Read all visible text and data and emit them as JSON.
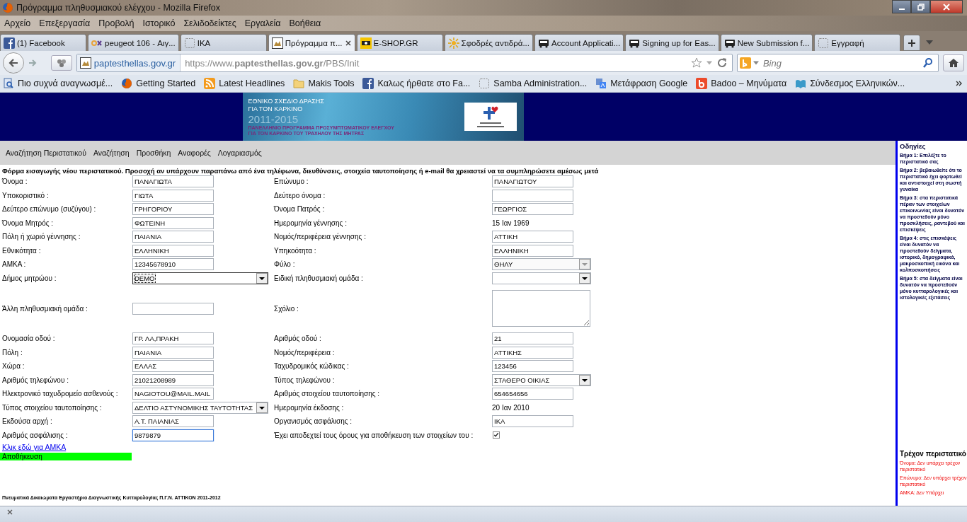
{
  "window": {
    "title": "Πρόγραμμα πληθυσμιακού ελέγχου - Mozilla Firefox"
  },
  "menu": [
    "Αρχείο",
    "Επεξεργασία",
    "Προβολή",
    "Ιστορικό",
    "Σελιδοδείκτες",
    "Εργαλεία",
    "Βοήθεια"
  ],
  "tabs": [
    {
      "label": "(1) Facebook",
      "selected": false
    },
    {
      "label": "peugeot 106 - Αιγ...",
      "selected": false
    },
    {
      "label": "IKA",
      "selected": false
    },
    {
      "label": "Πρόγραμμα π...",
      "selected": true
    },
    {
      "label": "E-SHOP.GR",
      "selected": false
    },
    {
      "label": "Σφοδρές αντιδρά...",
      "selected": false
    },
    {
      "label": "Account Applicati...",
      "selected": false
    },
    {
      "label": "Signing up for Eas...",
      "selected": false
    },
    {
      "label": "New Submission f...",
      "selected": false
    },
    {
      "label": "Εγγραφή",
      "selected": false
    }
  ],
  "address_bar": {
    "site": "paptesthellas.gov.gr",
    "url": "https://www.**paptesthellas.gov.gr**/PBS/Init"
  },
  "search": {
    "placeholder": "Bing"
  },
  "bookmarks": [
    "Πιο συχνά αναγνωσμέ...",
    "Getting Started",
    "Latest Headlines",
    "Makis Tools",
    "Καλως ήρθατε στο Fa...",
    "Samba Administration...",
    "Μετάφραση Google",
    "Badoo – Μηνύματα",
    "Σύνδεσμος Ελληνικών..."
  ],
  "banner": {
    "title_lines": [
      "ΕΘΝΙΚΟ ΣΧΕΔΙΟ ΔΡΑΣΗΣ",
      "ΓΙΑ ΤΟΝ ΚΑΡΚΙΝΟ"
    ],
    "years": "2011-2015",
    "subtitle_lines": [
      "ΠΑΝΕΛΛΗΝΙΟ ΠΡΟΓΡΑΜΜΑ ΠΡΟΣΥΜΠΤΩΜΑΤΙΚΟΥ ΕΛΕΓΧΟΥ",
      "ΓΙΑ ΤΟΝ ΚΑΡΚΙΝΟ ΤΟΥ ΤΡΑΧΗΛΟΥ ΤΗΣ ΜΗΤΡΑΣ"
    ]
  },
  "site_menu": [
    "Αναζήτηση Περιστατικού",
    "Αναζήτηση",
    "Προσθήκη",
    "Αναφορές",
    "Λογαριασμός"
  ],
  "form": {
    "heading": "Φόρμα εισαγωγής νέου περιστατικού. Προσοχή αν υπάρχουν παραπάνω από ένα τηλέφωνα, διευθύνσεις, στοιχεία ταυτοποίησης ή e-mail θα χρειαστεί να τα συμπληρώσετε αμέσως μετά",
    "rows": [
      {
        "left": {
          "label": "Όνομα :",
          "kind": "text",
          "value": "ΠΑΝΑΓΙΩΤΑ",
          "focused": false,
          "disabled": false
        },
        "right": {
          "label": "Επώνυμο :",
          "kind": "text",
          "value": "ΠΑΝΑΓΙΩΤΟΥ",
          "focused": false,
          "disabled": false
        }
      },
      {
        "left": {
          "label": "Υποκοριστικό :",
          "kind": "text",
          "value": "ΓΙΩΤΑ",
          "focused": false,
          "disabled": false
        },
        "right": {
          "label": "Δεύτερο όνομα :",
          "kind": "text",
          "focused": false,
          "disabled": false
        }
      },
      {
        "left": {
          "label": "Δεύτερο επώνυμο (συζύγου) :",
          "kind": "text",
          "value": "ΓΡΗΓΟΡΙΟΥ",
          "focused": false,
          "disabled": false
        },
        "right": {
          "label": "Όνομα Πατρός :",
          "kind": "text",
          "value": "ΓΕΩΡΓΙΟΣ",
          "focused": false,
          "disabled": false
        }
      },
      {
        "left": {
          "label": "Όνομα Μητρός :",
          "kind": "text",
          "value": "ΦΩΤΕΙΝΗ",
          "focused": false,
          "disabled": false
        },
        "right": {
          "label": "Ημερομηνία γέννησης :",
          "kind": "date",
          "value": "15 Ιαν 1969"
        }
      },
      {
        "left": {
          "label": "Πόλη ή χωριό γέννησης :",
          "kind": "text",
          "value": "ΠΑΙΑΝΙΑ",
          "focused": false,
          "disabled": false
        },
        "right": {
          "label": "Νομός/περιφέρεια γέννησης :",
          "kind": "text",
          "value": "ΑΤΤΙΚΗ",
          "focused": false,
          "disabled": false
        }
      },
      {
        "left": {
          "label": "Εθνικότητα :",
          "kind": "text",
          "value": "ΕΛΛΗΝΙΚΗ",
          "focused": false,
          "disabled": false
        },
        "right": {
          "label": "Υπηκοότητα :",
          "kind": "text",
          "value": "ΕΛΛΗΝΙΚΗ",
          "focused": false,
          "disabled": false
        }
      },
      {
        "left": {
          "label": "ΑΜΚΑ :",
          "kind": "text",
          "value": "12345678910",
          "focused": false,
          "disabled": false
        },
        "right": {
          "label": "Φύλο :",
          "kind": "select",
          "value": "ΘΗΛΥ",
          "focused": false,
          "disabled": true
        }
      },
      {
        "left": {
          "label": "Δήμος μητρώου :",
          "kind": "select",
          "value": "DEMO",
          "focused": true,
          "disabled": false
        },
        "right": {
          "label": "Ειδική πληθυσμιακή ομάδα :",
          "kind": "select",
          "focused": false,
          "disabled": false
        }
      },
      {
        "left": {
          "label": "Άλλη πληθυσμιακή ομάδα :",
          "kind": "text",
          "focused": false,
          "disabled": false
        },
        "right": {
          "label": "Σχόλιο :",
          "kind": "textarea",
          "focused": false,
          "disabled": false
        }
      },
      {
        "left": {
          "label": "Ονομασία οδού :",
          "kind": "text",
          "value": "ΓΡ. ΛΑ,ΠΡΑΚΗ",
          "focused": false,
          "disabled": false
        },
        "right": {
          "label": "Αριθμός οδού :",
          "kind": "text",
          "value": "21",
          "focused": false,
          "disabled": false
        }
      },
      {
        "left": {
          "label": "Πόλη :",
          "kind": "text",
          "value": "ΠΑΙΑΝΙΑ",
          "focused": false,
          "disabled": false
        },
        "right": {
          "label": "Νομός/περιφέρεια :",
          "kind": "text",
          "value": "ΑΤΤΙΚΗΣ",
          "focused": false,
          "disabled": false
        }
      },
      {
        "left": {
          "label": "Χώρα :",
          "kind": "text",
          "value": "ΕΛΛΑΣ",
          "focused": false,
          "disabled": false
        },
        "right": {
          "label": "Ταχυδρομικός κώδικας :",
          "kind": "text",
          "value": "123456",
          "focused": false,
          "disabled": false
        }
      },
      {
        "left": {
          "label": "Αριθμός τηλεφώνου :",
          "kind": "text",
          "value": "21021208989",
          "focused": false,
          "disabled": false
        },
        "right": {
          "label": "Τύπος τηλεφώνου :",
          "kind": "select",
          "value": "ΣΤΑΘΕΡΟ ΟΙΚΙΑΣ",
          "focused": false,
          "disabled": false
        }
      },
      {
        "left": {
          "label": "Ηλεκτρονικό ταχυδρομείο ασθενούς :",
          "kind": "text",
          "value": "NAGIOTOU@MAIL.MAIL",
          "focused": false,
          "disabled": false
        },
        "right": {
          "label": "Αριθμός στοιχείου ταυτοποίησης :",
          "kind": "text",
          "value": "654654656",
          "focused": false,
          "disabled": false
        }
      },
      {
        "left": {
          "label": "Τύπος στοιχείου ταυτοποίησης :",
          "kind": "select",
          "value": "ΔΕΛΤΙΟ ΑΣΤΥΝΟΜΙΚΗΣ ΤΑΥΤΟΤΗΤΑΣ",
          "focused": false,
          "disabled": false
        },
        "right": {
          "label": "Ημερομηνία έκδοσης :",
          "kind": "date",
          "value": "20 Ιαν 2010"
        }
      },
      {
        "left": {
          "label": "Εκδούσα αρχή :",
          "kind": "text",
          "value": "Α.Τ. ΠΑΙΑΝΙΑΣ",
          "focused": false,
          "disabled": false
        },
        "right": {
          "label": "Οργανισμός ασφάλισης :",
          "kind": "text",
          "value": "ΙΚΑ",
          "focused": false,
          "disabled": false
        }
      },
      {
        "left": {
          "label": "Αριθμός ασφάλισης :",
          "kind": "text",
          "value": "9879879",
          "focused": true,
          "disabled": false
        },
        "right": {
          "label": "Έχει αποδεχτεί τους όρους για αποθήκευση των στοιχείων του :",
          "kind": "checkbox",
          "checked": true
        }
      }
    ],
    "link": "Κλικ εδώ για ΑΜΚΑ",
    "save": "Αποθήκευση"
  },
  "footer": "Πνευματικά Δικαιώματα Εργαστήριο Διαγνωστικής Κυτταρολογίας Π.Γ.Ν. ΑΤΤΙΚΟΝ 2011-2012",
  "sidebar": {
    "title": "Οδηγίες",
    "steps": [
      "Βήμα 1: Επιλέξτε το περιστατικό σας",
      "Βήμα 2: βεβαιωθείτε ότι το περιστατικό έχει φορτωθεί και αντιστοιχεί στη σωστή γυναίκα",
      "Βήμα 3: στα περιστατικά πέραν των στοιχείων επικοινωνίας είναι δυνατόν να προστεθούν μόνο προσκλήσεις, ραντεβού και επισκέψεις",
      "Βήμα 4: στις επισκέψεις είναι δυνατόν να προστεθούν δείγματα, ιστορικό, δημογραφικά, μακροσκοπική εικόνα και κολποσκοπήσεις",
      "Βήμα 5: στα δείγματα είναι δυνατόν να προστεθούν μόνο κυτταρολογικές και ιστολογικές εξετάσεις"
    ],
    "current_title": "Τρέχον περιστατικό",
    "current_lines": [
      "Όνομα: Δεν υπάρχει τρέχον περιστατικό",
      "Επώνυμο: Δεν υπάρχει τρέχον περιστατικό",
      "ΑΜΚΑ: Δεν Υπάρχει"
    ]
  }
}
